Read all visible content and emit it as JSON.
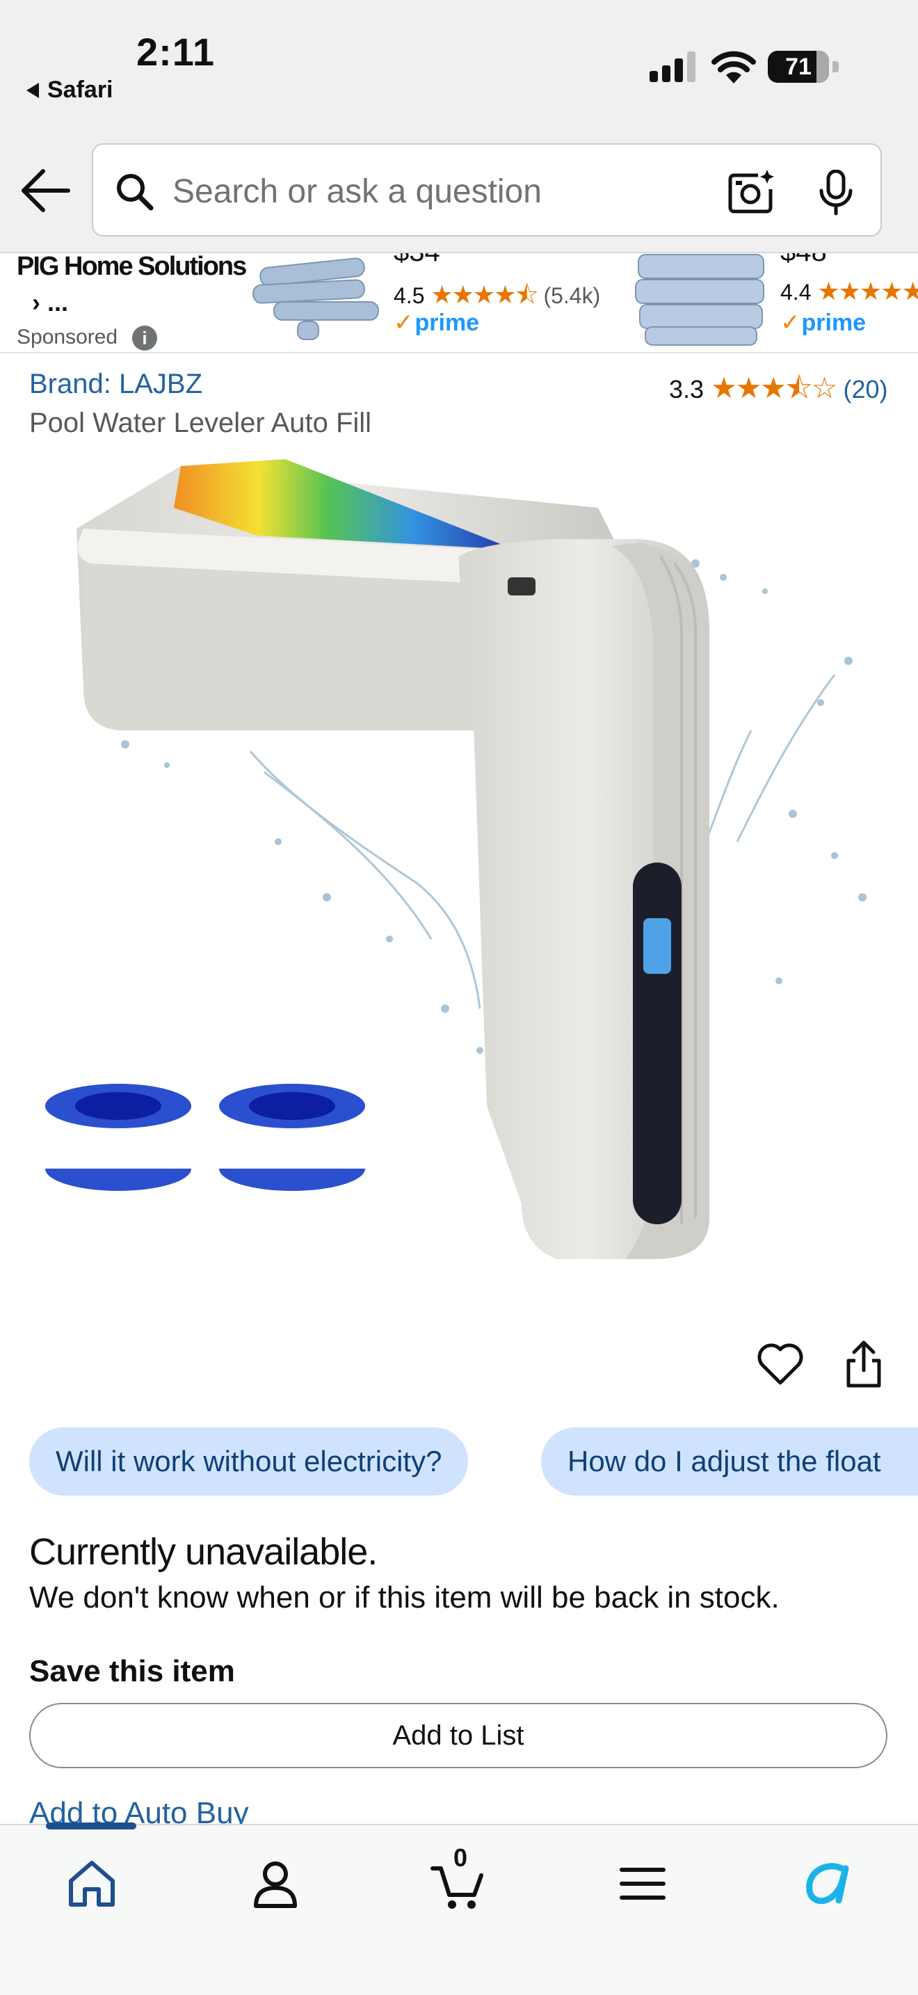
{
  "status_bar": {
    "time": "2:11",
    "back_app": "Safari",
    "battery": "71"
  },
  "search": {
    "placeholder": "Search or ask a question"
  },
  "sponsored": {
    "brand": "PIG Home Solutions",
    "brand_more": "› ...",
    "label": "Sponsored",
    "info_icon": "i",
    "ads": [
      {
        "price_fragment": "$34",
        "rating": "4.5",
        "stars": "★★★★⯪",
        "count": "(5.4k)",
        "prime": "prime"
      },
      {
        "price_fragment": "$48",
        "rating": "4.4",
        "stars": "★★★★★",
        "count": "",
        "prime": "prime"
      }
    ]
  },
  "product": {
    "brand_link": "Brand: LAJBZ",
    "rating": "3.3",
    "stars": "★★★⯪☆",
    "rating_count": "(20)",
    "title": "Pool Water Leveler Auto Fill"
  },
  "chips": [
    "Will it work without electricity?",
    "How do I adjust the float"
  ],
  "availability": {
    "headline": "Currently unavailable.",
    "message": "We don't know when or if this item will be back in stock."
  },
  "save": {
    "title": "Save this item",
    "add_to_list": "Add to List",
    "auto_buy": "Add to Auto Buy"
  },
  "tabbar": {
    "cart_count": "0"
  },
  "icons": [
    "back-arrow-icon",
    "search-icon",
    "camera-icon",
    "mic-icon",
    "heart-icon",
    "share-icon",
    "home-icon",
    "account-icon",
    "cart-icon",
    "menu-icon",
    "rufus-icon"
  ],
  "colors": {
    "link": "#2162a1",
    "star": "#e77600",
    "prime": "#1a98ff",
    "chip_bg": "#cfe3ff"
  }
}
